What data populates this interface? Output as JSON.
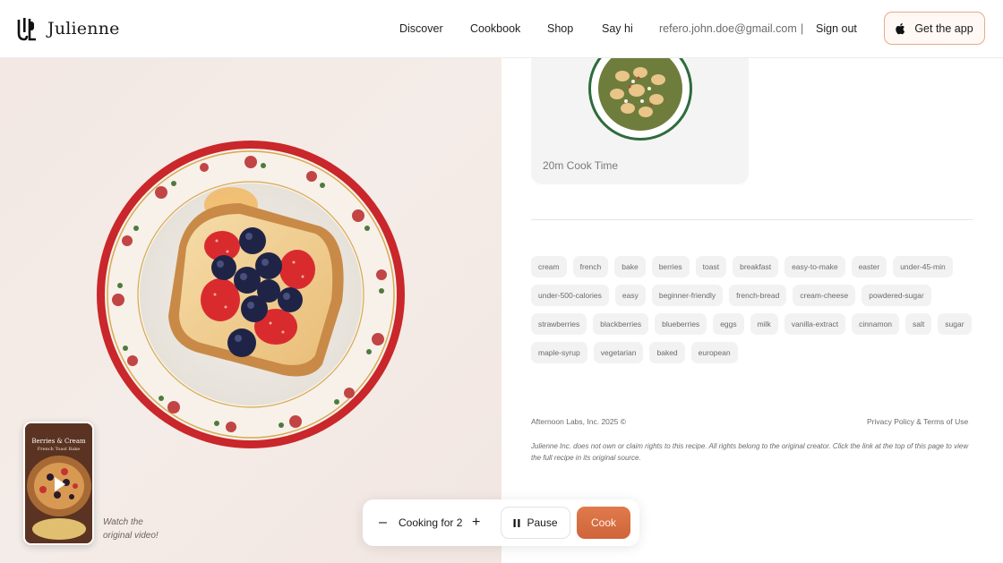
{
  "brand": {
    "name": "Julienne",
    "logo_icon": "julienne-logo-icon"
  },
  "nav": {
    "items": [
      "Discover",
      "Cookbook",
      "Shop",
      "Say hi"
    ],
    "email": "refero.john.doe@gmail.com",
    "separator": "|",
    "sign_out": "Sign out",
    "get_app": "Get the app",
    "get_app_icon": "apple-icon"
  },
  "hero": {
    "video_title": "Berries & Cream",
    "video_subtitle": "French Toast Bake",
    "watch_text_line1": "Watch the",
    "watch_text_line2": "original video!",
    "play_icon": "play-icon"
  },
  "card": {
    "cook_time": "20m Cook Time"
  },
  "tags": [
    "cream",
    "french",
    "bake",
    "berries",
    "toast",
    "breakfast",
    "easy-to-make",
    "easter",
    "under-45-min",
    "under-500-calories",
    "easy",
    "beginner-friendly",
    "french-bread",
    "cream-cheese",
    "powdered-sugar",
    "strawberries",
    "blackberries",
    "blueberries",
    "eggs",
    "milk",
    "vanilla-extract",
    "cinnamon",
    "salt",
    "sugar",
    "maple-syrup",
    "vegetarian",
    "baked",
    "european"
  ],
  "footer": {
    "copyright": "Afternoon Labs, Inc. 2025 ©",
    "links": "Privacy Policy & Terms of Use",
    "disclaimer": "Julienne Inc. does not own or claim rights to this recipe. All rights belong to the original creator. Click the link at the top of this page to view the full recipe in its original source."
  },
  "controls": {
    "minus": "–",
    "cooking_for": "Cooking for 2",
    "plus": "+",
    "pause": "Pause",
    "pause_icon": "pause-icon",
    "cook": "Cook"
  },
  "colors": {
    "accent": "#d96f43",
    "hero_bg": "#f3e9e5",
    "tag_bg": "#f2f2f2"
  }
}
